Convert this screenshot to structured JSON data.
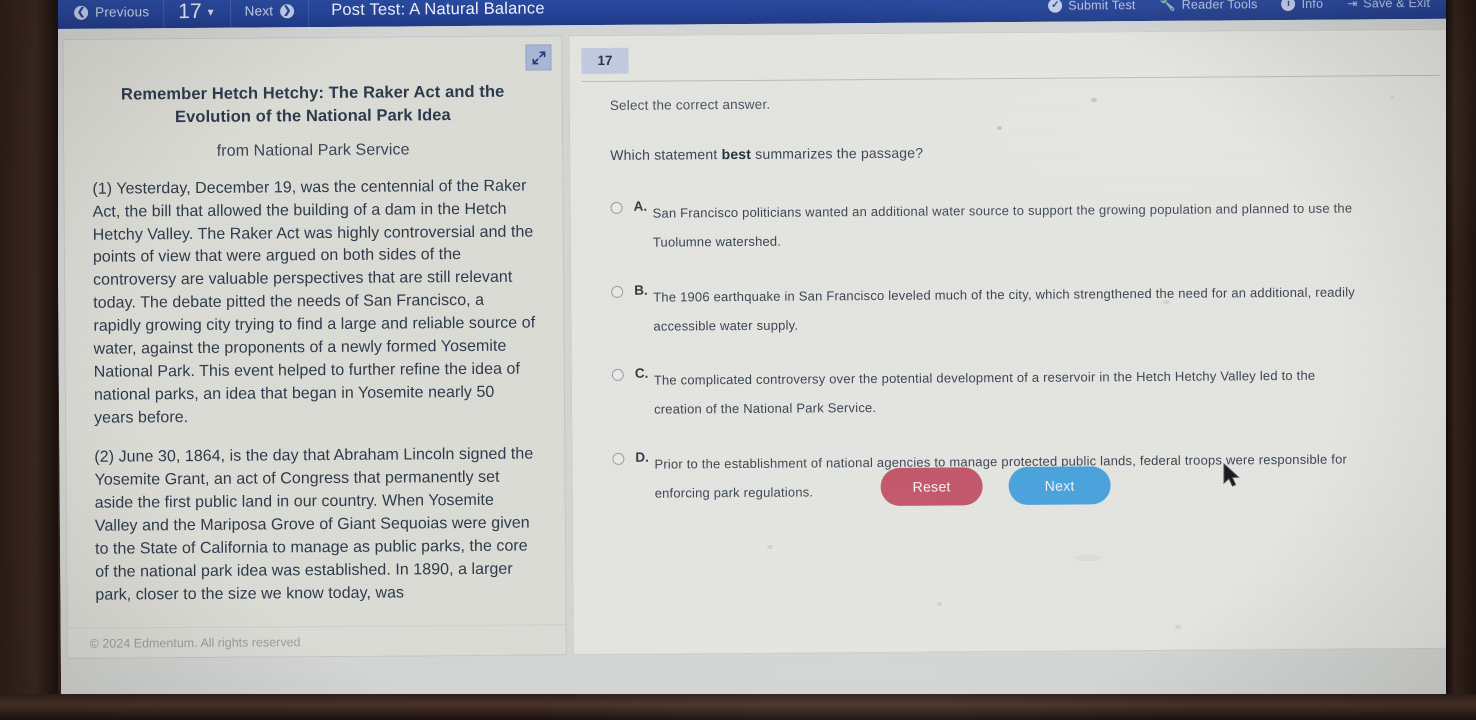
{
  "topbar": {
    "previous_label": "Previous",
    "previous_icon": "arrow-left-circle-icon",
    "question_number": "17",
    "dropdown_icon": "chevron-down-icon",
    "next_label": "Next",
    "next_icon": "arrow-right-circle-icon",
    "test_title": "Post Test: A Natural Balance",
    "right_items": [
      {
        "label": "Submit Test",
        "icon": "check-circle-icon"
      },
      {
        "label": "Reader Tools",
        "icon": "wrench-icon"
      },
      {
        "label": "Info",
        "icon": "info-circle-icon"
      },
      {
        "label": "Save & Exit",
        "icon": "exit-icon"
      }
    ],
    "bar_color": "#27459a"
  },
  "passage": {
    "expand_icon": "expand-arrows-icon",
    "title": "Remember Hetch Hetchy: The Raker Act and the Evolution of the National Park Idea",
    "source": "from National Park Service",
    "paragraphs": [
      "(1) Yesterday, December 19, was the centennial of the Raker Act, the bill that allowed the building of a dam in the Hetch Hetchy Valley. The Raker Act was highly controversial and the points of view that were argued on both sides of the controversy are valuable perspectives that are still relevant today. The debate pitted the needs of San Francisco, a rapidly growing city trying to find a large and reliable source of water, against the proponents of a newly formed Yosemite National Park. This event helped to further refine the idea of national parks, an idea that began in Yosemite nearly 50 years before.",
      "(2) June 30, 1864, is the day that Abraham Lincoln signed the Yosemite Grant, an act of Congress that permanently set aside the first public land in our country. When Yosemite Valley and the Mariposa Grove of Giant Sequoias were given to the State of California to manage as public parks, the core of the national park idea was established. In 1890, a larger park, closer to the size we know today, was"
    ],
    "footer": "© 2024 Edmentum. All rights reserved"
  },
  "question": {
    "number_badge": "17",
    "instruction": "Select the correct answer.",
    "prompt_before": "Which statement ",
    "prompt_emphasis": "best",
    "prompt_after": " summarizes the passage?",
    "options": [
      {
        "letter": "A.",
        "text": "San Francisco politicians wanted an additional water source to support the growing population and planned to use the Tuolumne watershed.",
        "selected": false
      },
      {
        "letter": "B.",
        "text": "The 1906 earthquake in San Francisco leveled much of the city, which strengthened the need for an additional, readily accessible water supply.",
        "selected": false
      },
      {
        "letter": "C.",
        "text": "The complicated controversy over the potential development of a reservoir in the Hetch Hetchy Valley led to the creation of the National Park Service.",
        "selected": false
      },
      {
        "letter": "D.",
        "text": "Prior to the establishment of national agencies to manage protected public lands, federal troops were responsible for enforcing park regulations.",
        "selected": false
      }
    ],
    "reset_label": "Reset",
    "next_label": "Next",
    "reset_color": "#c4566a",
    "next_color": "#4ba3dd"
  }
}
